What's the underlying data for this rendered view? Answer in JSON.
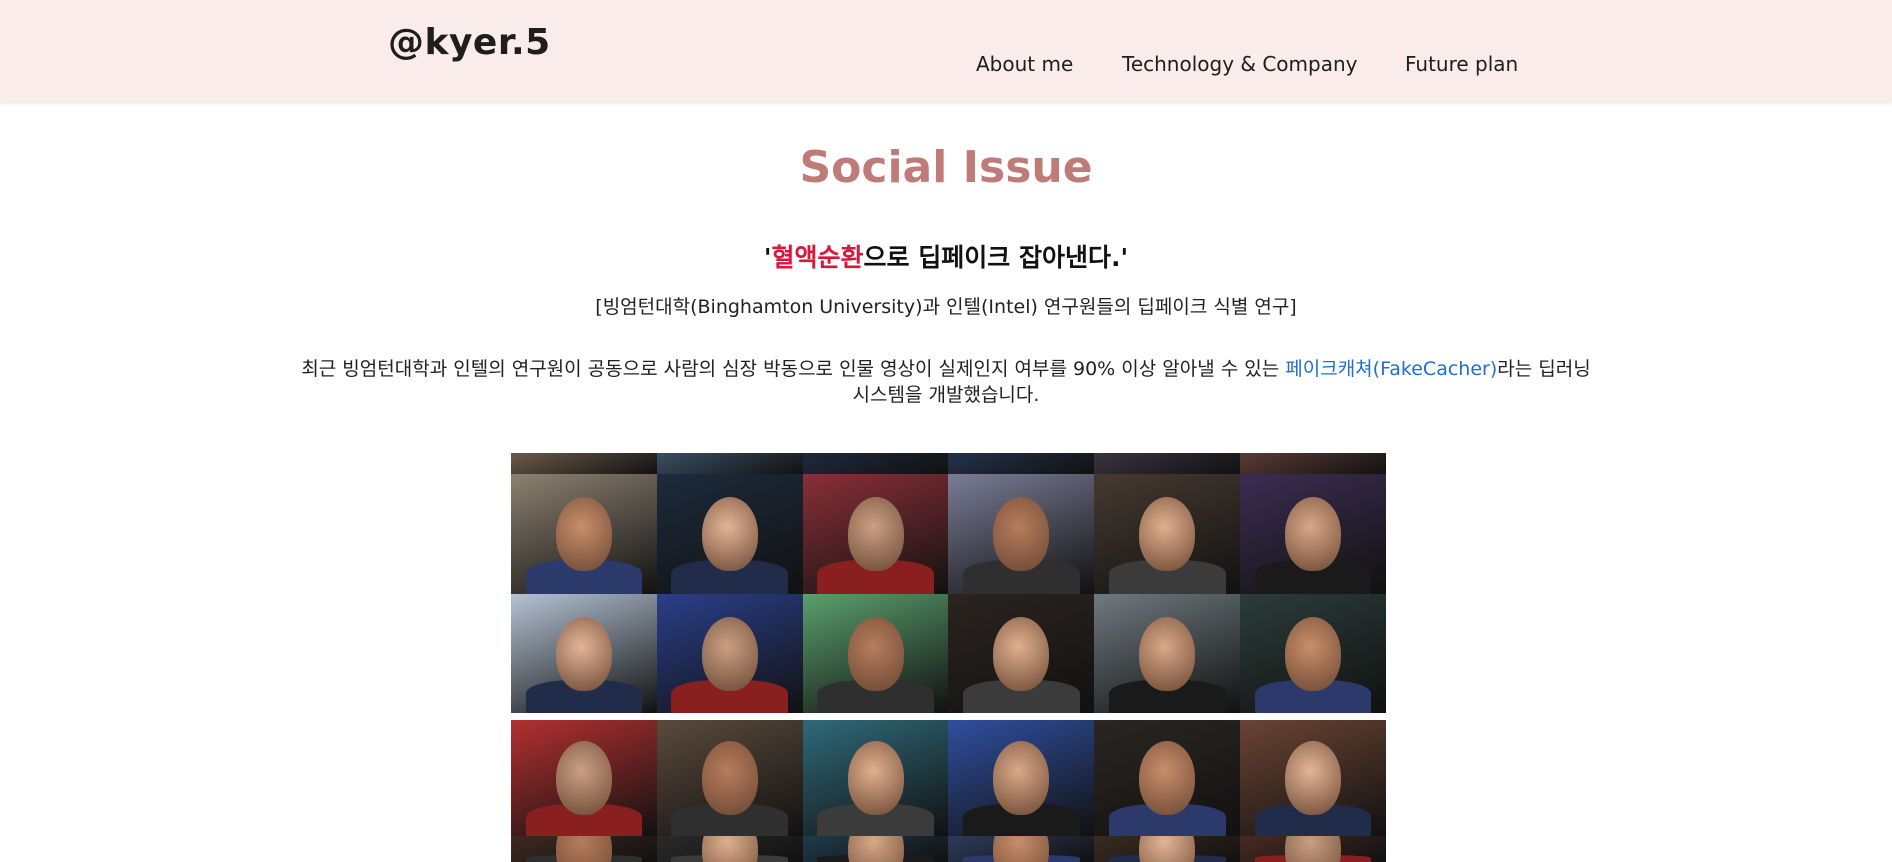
{
  "header": {
    "logo": "@kyer.5",
    "nav": [
      {
        "id": "about",
        "label": "About me"
      },
      {
        "id": "tech",
        "label": "Technology & Company"
      },
      {
        "id": "future",
        "label": "Future plan"
      }
    ]
  },
  "main": {
    "title": "Social Issue",
    "headline": {
      "quote_open": "'",
      "highlight": "혈액순환",
      "rest": "으로 딥페이크 잡아낸다.'"
    },
    "subheading": "[빙엄턴대학(Binghamton University)과 인텔(Intel) 연구원들의 딥페이크 식별 연구]",
    "body": {
      "before_link": "최근 빙엄턴대학과 인텔의 연구원이 공동으로 사람의 심장 박동으로 인물 영상이 실제인지 여부를 90% 이상 알아낼 수 있는 ",
      "link": "페이크캐쳐(FakeCacher)",
      "after_link": "라는 딥러닝 시스템을 개발했습니다."
    }
  },
  "colors": {
    "header_bg": "#f9ecea",
    "title": "#bf7b78",
    "highlight": "#d9173c",
    "link": "#1f6fd1"
  }
}
